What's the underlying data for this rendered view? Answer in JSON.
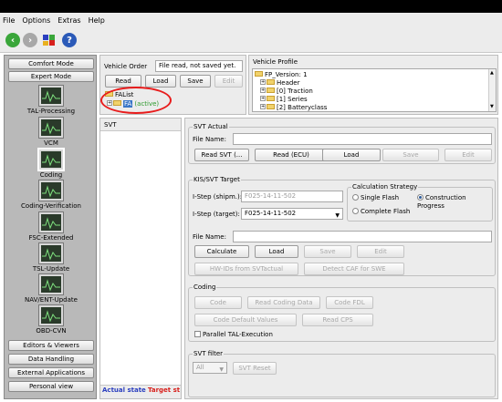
{
  "menu": [
    "File",
    "Options",
    "Extras",
    "Help"
  ],
  "toolbar": {
    "icons": [
      "back-icon",
      "forward-icon",
      "puzzle-icon",
      "help-icon"
    ]
  },
  "sidebar": {
    "top_buttons": [
      "Comfort Mode",
      "Expert Mode"
    ],
    "items": [
      "TAL-Processing",
      "VCM",
      "Coding",
      "Coding-Verification",
      "FSC-Extended",
      "TSL-Update",
      "NAV/ENT-Update",
      "OBD-CVN"
    ],
    "bottom_buttons": [
      "Editors & Viewers",
      "Data Handling",
      "External Applications",
      "Personal view"
    ]
  },
  "vehicle_order": {
    "label": "Vehicle Order",
    "status": "File read, not saved yet.",
    "read": "Read",
    "load": "Load",
    "save": "Save",
    "edit": "Edit",
    "tree_root": "FAList",
    "tree_child": "FA",
    "tree_child_suffix": "(active)"
  },
  "vehicle_profile": {
    "label": "Vehicle Profile",
    "items": [
      "FP_Version: 1",
      "Header",
      "[0] Traction",
      "[1] Series",
      "[2] Batteryclass"
    ]
  },
  "svt_list": {
    "label": "SVT",
    "actual_state": "Actual state",
    "target_state": "Target st"
  },
  "svt_actual": {
    "title": "SVT Actual",
    "file_name_label": "File Name:",
    "file_name_value": "",
    "read_svt": "Read SVT (...",
    "read_ecu": "Read (ECU)",
    "load": "Load",
    "save": "Save",
    "edit": "Edit"
  },
  "kis_target": {
    "title": "KIS/SVT Target",
    "istep_shipm_label": "I-Step (shipm.):",
    "istep_shipm_value": "F025-14-11-502",
    "istep_target_label": "I-Step (target):",
    "istep_target_value": "F025-14-11-502",
    "calc_title": "Calculation Strategy",
    "single_flash": "Single Flash",
    "construction_progress": "Construction Progress",
    "complete_flash": "Complete Flash",
    "selected_strategy": "Construction Progress",
    "file_name_label": "File Name:",
    "file_name_value": "",
    "calculate": "Calculate",
    "load": "Load",
    "save": "Save",
    "edit": "Edit",
    "hw_ids": "HW-IDs from SVTactual",
    "detect_caf": "Detect CAF for SWE"
  },
  "coding": {
    "title": "Coding",
    "code": "Code",
    "read_coding_data": "Read Coding Data",
    "code_fdl": "Code FDL",
    "code_default_values": "Code Default Values",
    "read_cps": "Read CPS",
    "parallel_tal": "Parallel TAL-Execution"
  },
  "svt_filter": {
    "title": "SVT filter",
    "filter_value": "All",
    "svt_reset": "SVT Reset"
  },
  "colors": {
    "accent_blue": "#2b3fbf",
    "accent_red": "#d8201c",
    "annotation_red": "#e81c1c",
    "selection_blue": "#3a76c8",
    "active_green": "#2e9a2e"
  }
}
